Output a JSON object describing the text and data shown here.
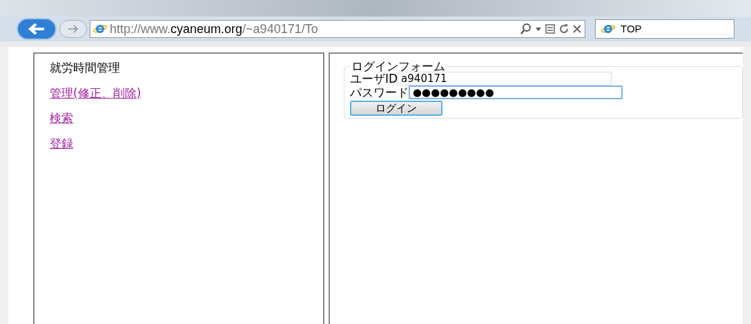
{
  "browser": {
    "address_parts": [
      {
        "text": "http://www.",
        "bold": false
      },
      {
        "text": "cyaneum.org",
        "bold": true
      },
      {
        "text": "/~a940171/To",
        "bold": false
      }
    ],
    "tab": {
      "title": "TOP",
      "selected": true
    }
  },
  "menu_frame": {
    "title": "就労時間管理",
    "links": [
      {
        "label": "管理(修正、削除)"
      },
      {
        "label": "検索"
      },
      {
        "label": "登録"
      }
    ]
  },
  "login_form": {
    "legend": "ログインフォーム",
    "fields": [
      {
        "label": "ユーザID",
        "value": "a940171",
        "focused": false
      },
      {
        "label": "パスワード",
        "value": "●●●●●●●●●",
        "focused": true
      }
    ],
    "button": "ログイン"
  }
}
